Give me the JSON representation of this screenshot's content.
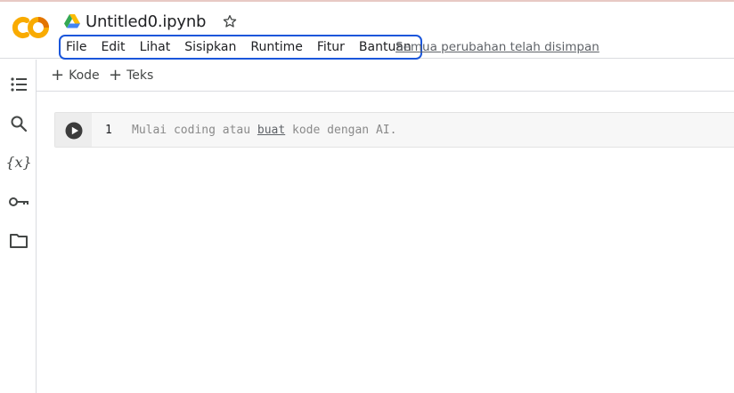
{
  "app": {
    "logo_text": "CO",
    "notebook_title": "Untitled0.ipynb",
    "accent_colors": {
      "logo_orange": "#f9ab00",
      "logo_dark_orange": "#e37400",
      "menu_outline": "#1a56db"
    }
  },
  "menu": {
    "items": [
      {
        "label": "File"
      },
      {
        "label": "Edit"
      },
      {
        "label": "Lihat"
      },
      {
        "label": "Sisipkan"
      },
      {
        "label": "Runtime"
      },
      {
        "label": "Fitur"
      },
      {
        "label": "Bantuan"
      }
    ],
    "save_status": "Semua perubahan telah disimpan"
  },
  "sidebar": {
    "icons": [
      "table-of-contents-icon",
      "search-icon",
      "variables-icon",
      "secrets-key-icon",
      "files-folder-icon"
    ],
    "variables_glyph": "{x}"
  },
  "toolbar": {
    "add_code_label": "Kode",
    "add_text_label": "Teks"
  },
  "cell": {
    "line_number": "1",
    "placeholder_before": "Mulai coding atau ",
    "placeholder_link": "buat",
    "placeholder_after": " kode dengan AI."
  }
}
